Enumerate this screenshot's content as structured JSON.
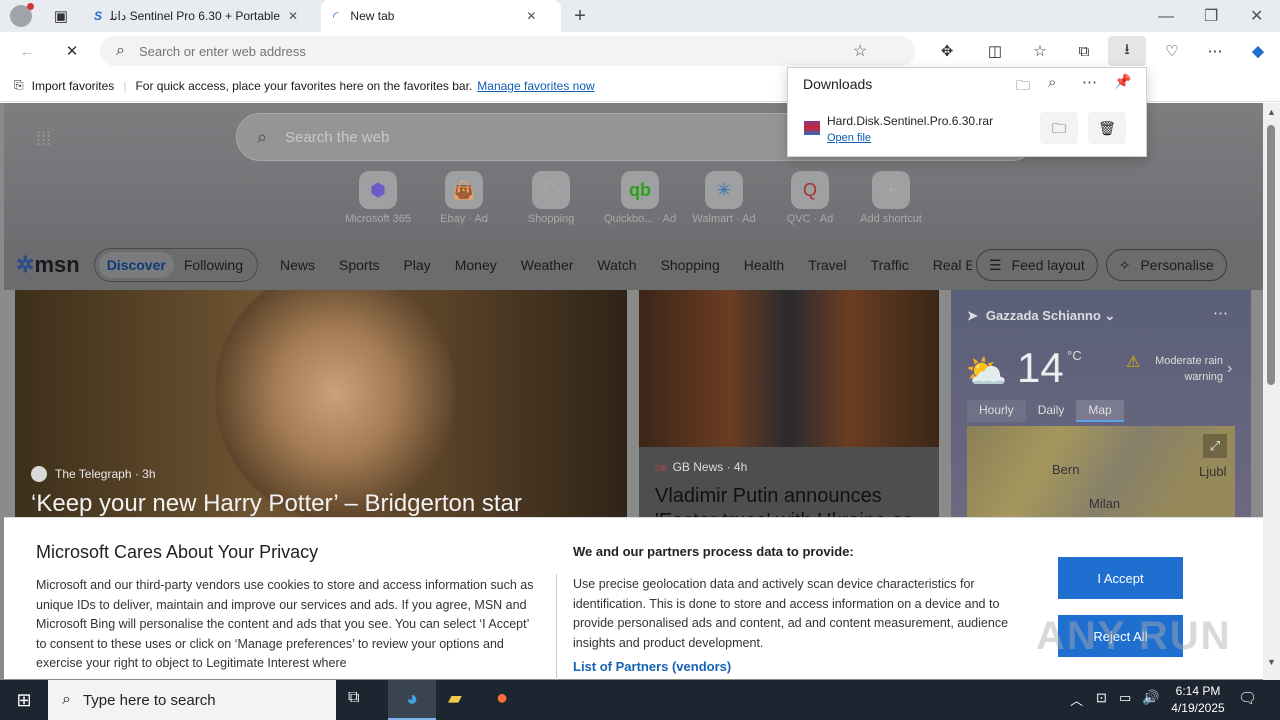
{
  "browser": {
    "tabs": [
      {
        "title": "Sentinel Pro 6.30 + Portable دانلود"
      },
      {
        "title": "New tab"
      }
    ],
    "address": {
      "placeholder": "Search or enter web address"
    },
    "favbar": {
      "import_label": "Import favorites",
      "message": "For quick access, place your favorites here on the favorites bar.",
      "manage_link": "Manage favorites now"
    }
  },
  "downloads": {
    "title": "Downloads",
    "file": "Hard.Disk.Sentinel.Pro.6.30.rar",
    "open_link": "Open file"
  },
  "newtab": {
    "search_placeholder": "Search the web",
    "shortcuts": [
      {
        "label": "Microsoft 365",
        "ad": ""
      },
      {
        "label": "Ebay",
        "ad": "· Ad"
      },
      {
        "label": "Shopping",
        "ad": ""
      },
      {
        "label": "Quickbo...",
        "ad": "· Ad"
      },
      {
        "label": "Walmart",
        "ad": "· Ad"
      },
      {
        "label": "QVC",
        "ad": "· Ad"
      },
      {
        "label": "Add shortcut",
        "ad": ""
      }
    ]
  },
  "msn": {
    "logo": "msn",
    "tabs": [
      "Discover",
      "Following"
    ],
    "nav": [
      "News",
      "Sports",
      "Play",
      "Money",
      "Weather",
      "Watch",
      "Shopping",
      "Health",
      "Travel",
      "Traffic",
      "Real E"
    ],
    "feed_layout": "Feed layout",
    "personalise": "Personalise",
    "card1": {
      "source": "The Telegraph",
      "age": "· 3h",
      "headline": "‘Keep your new Harry Potter’ – Bridgerton star"
    },
    "card2": {
      "source": "GB News",
      "age": "· 4h",
      "headline": "Vladimir Putin announces",
      "headline2": "'Easter truce' with Ukraine as"
    },
    "weather": {
      "location": "Gazzada Schianno",
      "temp": "14",
      "unit": "°C",
      "warning": "Moderate rain warning",
      "tabs": [
        "Hourly",
        "Daily",
        "Map"
      ],
      "map_labels": [
        "Bern",
        "Ljubl",
        "Milan"
      ]
    }
  },
  "privacy": {
    "title": "Microsoft Cares About Your Privacy",
    "body": "Microsoft and our third-party vendors use cookies to store and access information such as unique IDs to deliver, maintain and improve our services and ads. If you agree, MSN and Microsoft Bing will personalise the content and ads that you see. You can select ‘I Accept’ to consent to these uses or click on ‘Manage preferences’ to review your options and exercise your right to object to Legitimate Interest where",
    "partners_title": "We and our partners process data to provide:",
    "partners_body": "Use precise geolocation data and actively scan device characteristics for identification. This is done to store and access information on a device and to provide personalised ads and content, ad and content measurement, audience insights and product development.",
    "partners_link": "List of Partners (vendors)",
    "accept": "I Accept",
    "reject": "Reject All"
  },
  "taskbar": {
    "search_placeholder": "Type here to search",
    "time": "6:14 PM",
    "date": "4/19/2025"
  },
  "watermark": "ANY RUN"
}
